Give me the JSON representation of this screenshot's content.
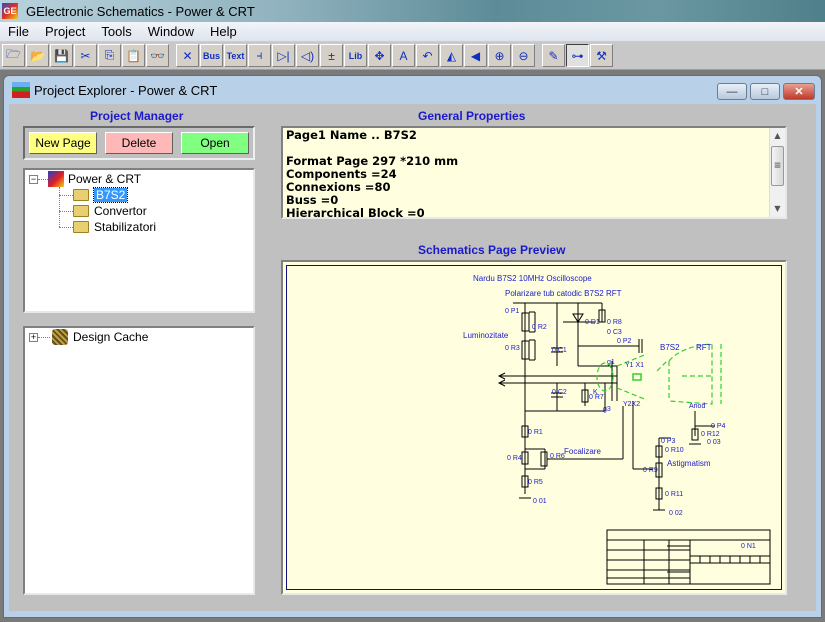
{
  "app": {
    "title": "GElectronic Schematics - Power & CRT",
    "icon": "gelectronic-app-icon"
  },
  "menu": [
    "File",
    "Project",
    "Tools",
    "Window",
    "Help"
  ],
  "toolbar": {
    "file_group": [
      {
        "name": "new-icon",
        "glyph": "🗁"
      },
      {
        "name": "open-icon",
        "glyph": "📂"
      },
      {
        "name": "save-icon",
        "glyph": "💾"
      },
      {
        "name": "cut-icon",
        "glyph": "✂"
      },
      {
        "name": "copy-icon",
        "glyph": "⎘"
      },
      {
        "name": "paste-icon",
        "glyph": "📋"
      },
      {
        "name": "find-icon",
        "glyph": "👓"
      }
    ],
    "draw_group": [
      {
        "name": "wire-icon",
        "glyph": "✕"
      },
      {
        "name": "bus-icon",
        "glyph": "Bus"
      },
      {
        "name": "text-icon",
        "glyph": "Text"
      },
      {
        "name": "component-icon",
        "glyph": "⫞"
      },
      {
        "name": "diode-icon",
        "glyph": "▷|"
      },
      {
        "name": "speaker-icon",
        "glyph": "◁)"
      },
      {
        "name": "power-icon",
        "glyph": "±"
      },
      {
        "name": "library-icon",
        "glyph": "Lib"
      },
      {
        "name": "move-icon",
        "glyph": "✥"
      },
      {
        "name": "move-text-icon",
        "glyph": "A"
      },
      {
        "name": "rotate-icon",
        "glyph": "↶"
      },
      {
        "name": "mirror-icon",
        "glyph": "◭"
      },
      {
        "name": "flip-icon",
        "glyph": "◀"
      },
      {
        "name": "zoom-in-icon",
        "glyph": "⊕"
      },
      {
        "name": "zoom-out-icon",
        "glyph": "⊖"
      }
    ],
    "tools_group": [
      {
        "name": "edit-pencil-icon",
        "glyph": "✎",
        "pressed": false
      },
      {
        "name": "hierarchy-icon",
        "glyph": "⊶",
        "pressed": true
      },
      {
        "name": "tools-icon",
        "glyph": "⚒",
        "pressed": false
      }
    ]
  },
  "child_window": {
    "title": "Project Explorer - Power & CRT",
    "controls": {
      "minimize": "—",
      "maximize": "□",
      "close": "✕"
    }
  },
  "project_manager": {
    "heading": "Project  Manager",
    "buttons": {
      "new_page": "New Page",
      "delete": "Delete",
      "open": "Open"
    },
    "button_colors": {
      "new_page": "#ffff80",
      "delete": "#ffb8b8",
      "open": "#80ff80"
    },
    "tree": {
      "root": "Power & CRT",
      "pages": [
        "B7S2",
        "Convertor",
        "Stabilizatori"
      ],
      "selected": "B7S2"
    },
    "cache_tree": {
      "root": "Design Cache"
    }
  },
  "general_properties": {
    "heading": "General Properties",
    "lines": [
      "Page1  Name .. B7S2",
      "",
      "Format Page 297 *210 mm",
      "Components =24",
      "Connexions =80",
      "Buss =0",
      "Hierarchical Block =0"
    ]
  },
  "preview": {
    "heading": "Schematics Page Preview",
    "title_line1": "Nardu B7S2 10MHz Oscilloscope",
    "title_line2": "Polarizare tub catodic B7S2 RFT",
    "labels": {
      "luminozitate": "Luminozitate",
      "focalizare": "Focalizare",
      "astigmatism": "Astigmatism",
      "anod": "Anod",
      "tube": "B7S2",
      "tube_maker": "RFT",
      "p1": "0 P1",
      "r2": "0 R2",
      "r3": "0 R3",
      "c1": "0 C1",
      "c2": "0 C2",
      "d1": "0 D1",
      "r8": "0 R8",
      "c3": "0 C3",
      "p2": "0 P2",
      "r7": "0 R7",
      "r1": "0 R1",
      "r4": "0 R4",
      "r6": "0 R6",
      "r5": "0 R5",
      "o1": "0 01",
      "p3": "0 P3",
      "r10": "0 R10",
      "r9": "0 R9",
      "r11": "0 R11",
      "o2": "0 02",
      "p4": "0 P4",
      "r12": "0 R12",
      "o3": "0 03",
      "y1x1": "Y1 X1",
      "y2x2": "Y2X2",
      "g1": "g1",
      "g3": "g3",
      "k": "K",
      "n1": "0 N1"
    }
  }
}
